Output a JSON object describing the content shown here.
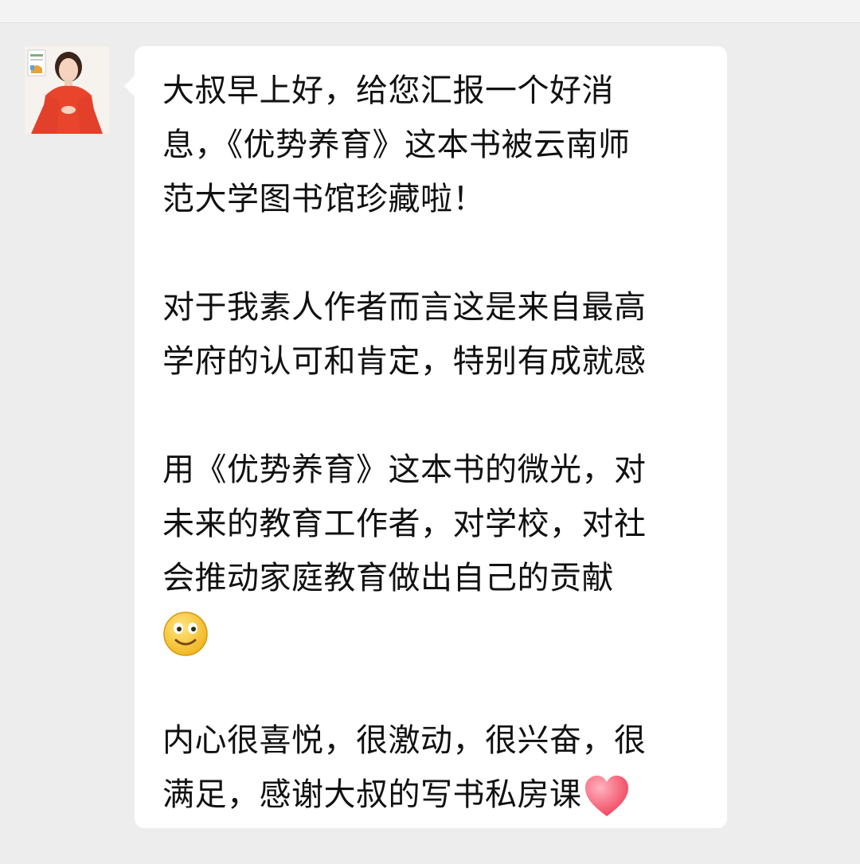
{
  "chat": {
    "avatar": {
      "icon": "woman-in-red-dress-avatar",
      "dress_color": "#e8452c"
    },
    "message": {
      "paragraph1": [
        "大叔早上好，给您汇报一个好消",
        "息，《优势养育》这本书被云南师",
        "范大学图书馆珍藏啦！"
      ],
      "paragraph2": [
        "对于我素人作者而言这是来自最高",
        "学府的认可和肯定，特别有成就感"
      ],
      "paragraph3": [
        "用《优势养育》这本书的微光，对",
        "未来的教育工作者，对学校，对社",
        "会推动家庭教育做出自己的贡献"
      ],
      "paragraph3_emoji": "smiley-face-emoji",
      "paragraph4": [
        "内心很喜悦，很激动，很兴奋，很",
        "满足，感谢大叔的写书私房课"
      ],
      "paragraph4_emoji": "heart-emoji"
    },
    "colors": {
      "background": "#ededed",
      "bubble": "#ffffff",
      "text": "#111111",
      "heart": "#ff5a6e",
      "smiley": "#f7c325"
    }
  }
}
